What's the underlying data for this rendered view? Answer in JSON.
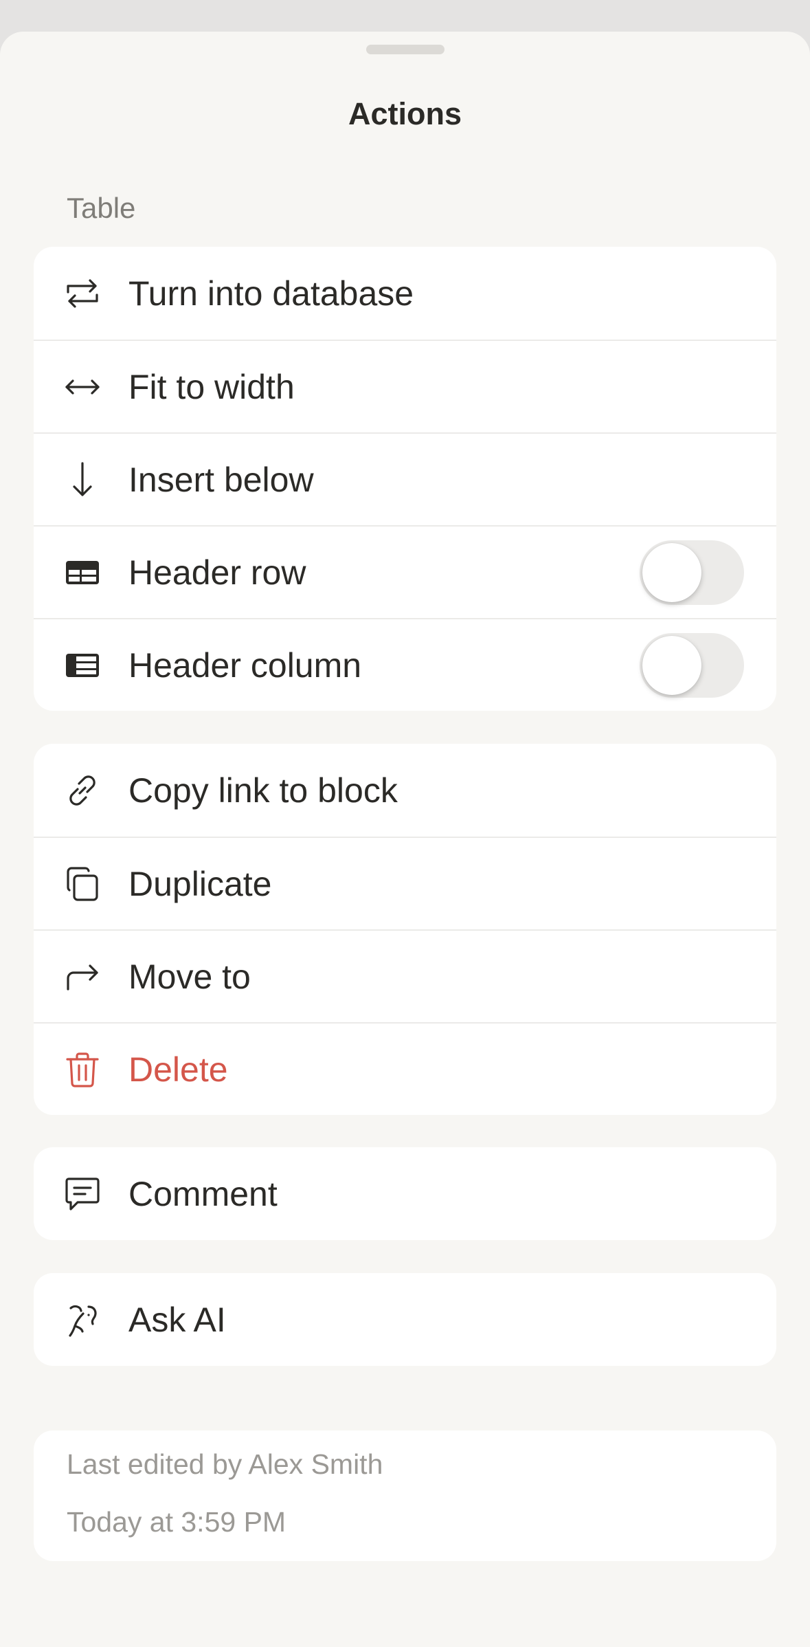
{
  "sheet": {
    "title": "Actions",
    "section_label": "Table"
  },
  "table_group": [
    {
      "name": "turn-into-database",
      "icon": "convert-icon",
      "label": "Turn into database"
    },
    {
      "name": "fit-to-width",
      "icon": "arrows-horizontal-icon",
      "label": "Fit to width"
    },
    {
      "name": "insert-below",
      "icon": "arrow-down-icon",
      "label": "Insert below"
    },
    {
      "name": "header-row",
      "icon": "table-header-row-icon",
      "label": "Header row",
      "toggle_on": false
    },
    {
      "name": "header-column",
      "icon": "table-header-column-icon",
      "label": "Header column",
      "toggle_on": false
    }
  ],
  "block_group": [
    {
      "name": "copy-link",
      "icon": "link-icon",
      "label": "Copy link to block"
    },
    {
      "name": "duplicate",
      "icon": "duplicate-icon",
      "label": "Duplicate"
    },
    {
      "name": "move-to",
      "icon": "arrow-turn-right-icon",
      "label": "Move to"
    },
    {
      "name": "delete",
      "icon": "trash-icon",
      "label": "Delete",
      "color": "#d4564a"
    }
  ],
  "comment_group": [
    {
      "name": "comment",
      "icon": "comment-icon",
      "label": "Comment"
    }
  ],
  "ai_group": [
    {
      "name": "ask-ai",
      "icon": "ai-face-icon",
      "label": "Ask AI"
    }
  ],
  "info": {
    "last_edited": "Last edited by Alex Smith",
    "timestamp": "Today at 3:59 PM"
  },
  "colors": {
    "background": "#f7f6f3",
    "card": "#ffffff",
    "text": "#2b2a27",
    "danger": "#d4564a",
    "muted": "#9b9995"
  }
}
